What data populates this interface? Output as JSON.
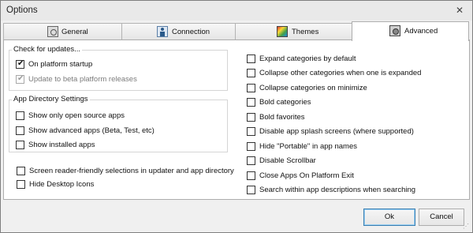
{
  "window": {
    "title": "Options",
    "close_glyph": "✕"
  },
  "tabs": [
    {
      "label": "General",
      "icon": "general-settings-icon",
      "active": false
    },
    {
      "label": "Connection",
      "icon": "connection-user-icon",
      "active": false
    },
    {
      "label": "Themes",
      "icon": "themes-palette-icon",
      "active": false
    },
    {
      "label": "Advanced",
      "icon": "advanced-camera-icon",
      "active": true
    }
  ],
  "updates": {
    "title": "Check for updates...",
    "items": [
      {
        "label": "On platform startup",
        "checked": true,
        "disabled": false
      },
      {
        "label": "Update to beta platform releases",
        "checked": true,
        "disabled": true
      }
    ]
  },
  "app_directory": {
    "title": "App Directory Settings",
    "items": [
      {
        "label": "Show only open source apps",
        "checked": false
      },
      {
        "label": "Show advanced apps (Beta, Test, etc)",
        "checked": false
      },
      {
        "label": "Show installed apps",
        "checked": false
      }
    ]
  },
  "left_extra": [
    {
      "label": "Screen reader-friendly selections in updater and app directory",
      "checked": false
    },
    {
      "label": "Hide Desktop Icons",
      "checked": false
    }
  ],
  "right_options": [
    {
      "label": "Expand categories by default",
      "checked": false
    },
    {
      "label": "Collapse other categories when one is expanded",
      "checked": false
    },
    {
      "label": "Collapse categories on minimize",
      "checked": false
    },
    {
      "label": "Bold categories",
      "checked": false
    },
    {
      "label": "Bold favorites",
      "checked": false
    },
    {
      "label": "Disable app splash screens (where supported)",
      "checked": false
    },
    {
      "label": "Hide \"Portable\" in app names",
      "checked": false
    },
    {
      "label": "Disable Scrollbar",
      "checked": false
    },
    {
      "label": "Close Apps On Platform Exit",
      "checked": false
    },
    {
      "label": "Search within app descriptions when searching",
      "checked": false
    }
  ],
  "buttons": {
    "ok": "Ok",
    "cancel": "Cancel"
  },
  "colors": {
    "dialog_bg": "#f0f0f0",
    "panel_bg": "#ffffff",
    "default_button_border": "#3c7fb1"
  }
}
